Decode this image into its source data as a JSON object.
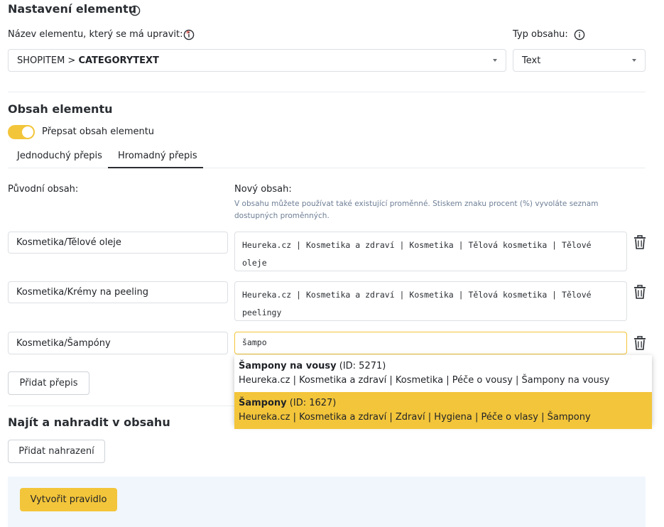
{
  "settings": {
    "title": "Nastavení elementu",
    "element_label": "Název elementu, který se má upravit:",
    "required_mark": "*",
    "element_value_prefix": "SHOPITEM > ",
    "element_value_bold": "CATEGORYTEXT",
    "type_label": "Typ obsahu:",
    "type_value": "Text"
  },
  "content": {
    "title": "Obsah elementu",
    "toggle_label": "Přepsat obsah elementu",
    "tabs": [
      "Jednoduchý přepis",
      "Hromadný přepis"
    ],
    "active_tab": 1,
    "original_label": "Původní obsah:",
    "new_label": "Nový obsah:",
    "hint": "V obsahu můžete používat také existující proměnné. Stiskem znaku procent (%) vyvoláte seznam dostupných proměnných.",
    "rows": [
      {
        "original": "Kosmetika/Tělové oleje",
        "new": "Heureka.cz | Kosmetika a zdraví | Kosmetika | Tělová kosmetika | Tělové oleje"
      },
      {
        "original": "Kosmetika/Krémy na peeling",
        "new": "Heureka.cz | Kosmetika a zdraví | Kosmetika | Tělová kosmetika | Tělové peelingy"
      },
      {
        "original": "Kosmetika/Šampóny",
        "new": "šampo"
      }
    ],
    "add_button": "Přidat přepis"
  },
  "suggestions": [
    {
      "name": "Šampony na vousy",
      "id": "(ID: 5271)",
      "path": "Heureka.cz | Kosmetika a zdraví | Kosmetika | Péče o vousy | Šampony na vousy",
      "selected": false
    },
    {
      "name": "Šampony",
      "id": "(ID: 1627)",
      "path": "Heureka.cz | Kosmetika a zdraví | Zdraví | Hygiena | Péče o vlasy | Šampony",
      "selected": true
    }
  ],
  "find_replace": {
    "title": "Najít a nahradit v obsahu",
    "add_button": "Přidat nahrazení"
  },
  "footer": {
    "create_button": "Vytvořit pravidlo"
  },
  "colors": {
    "accent": "#f3c53a",
    "footer_bg": "#f1f6fd",
    "required": "#e0302c"
  }
}
